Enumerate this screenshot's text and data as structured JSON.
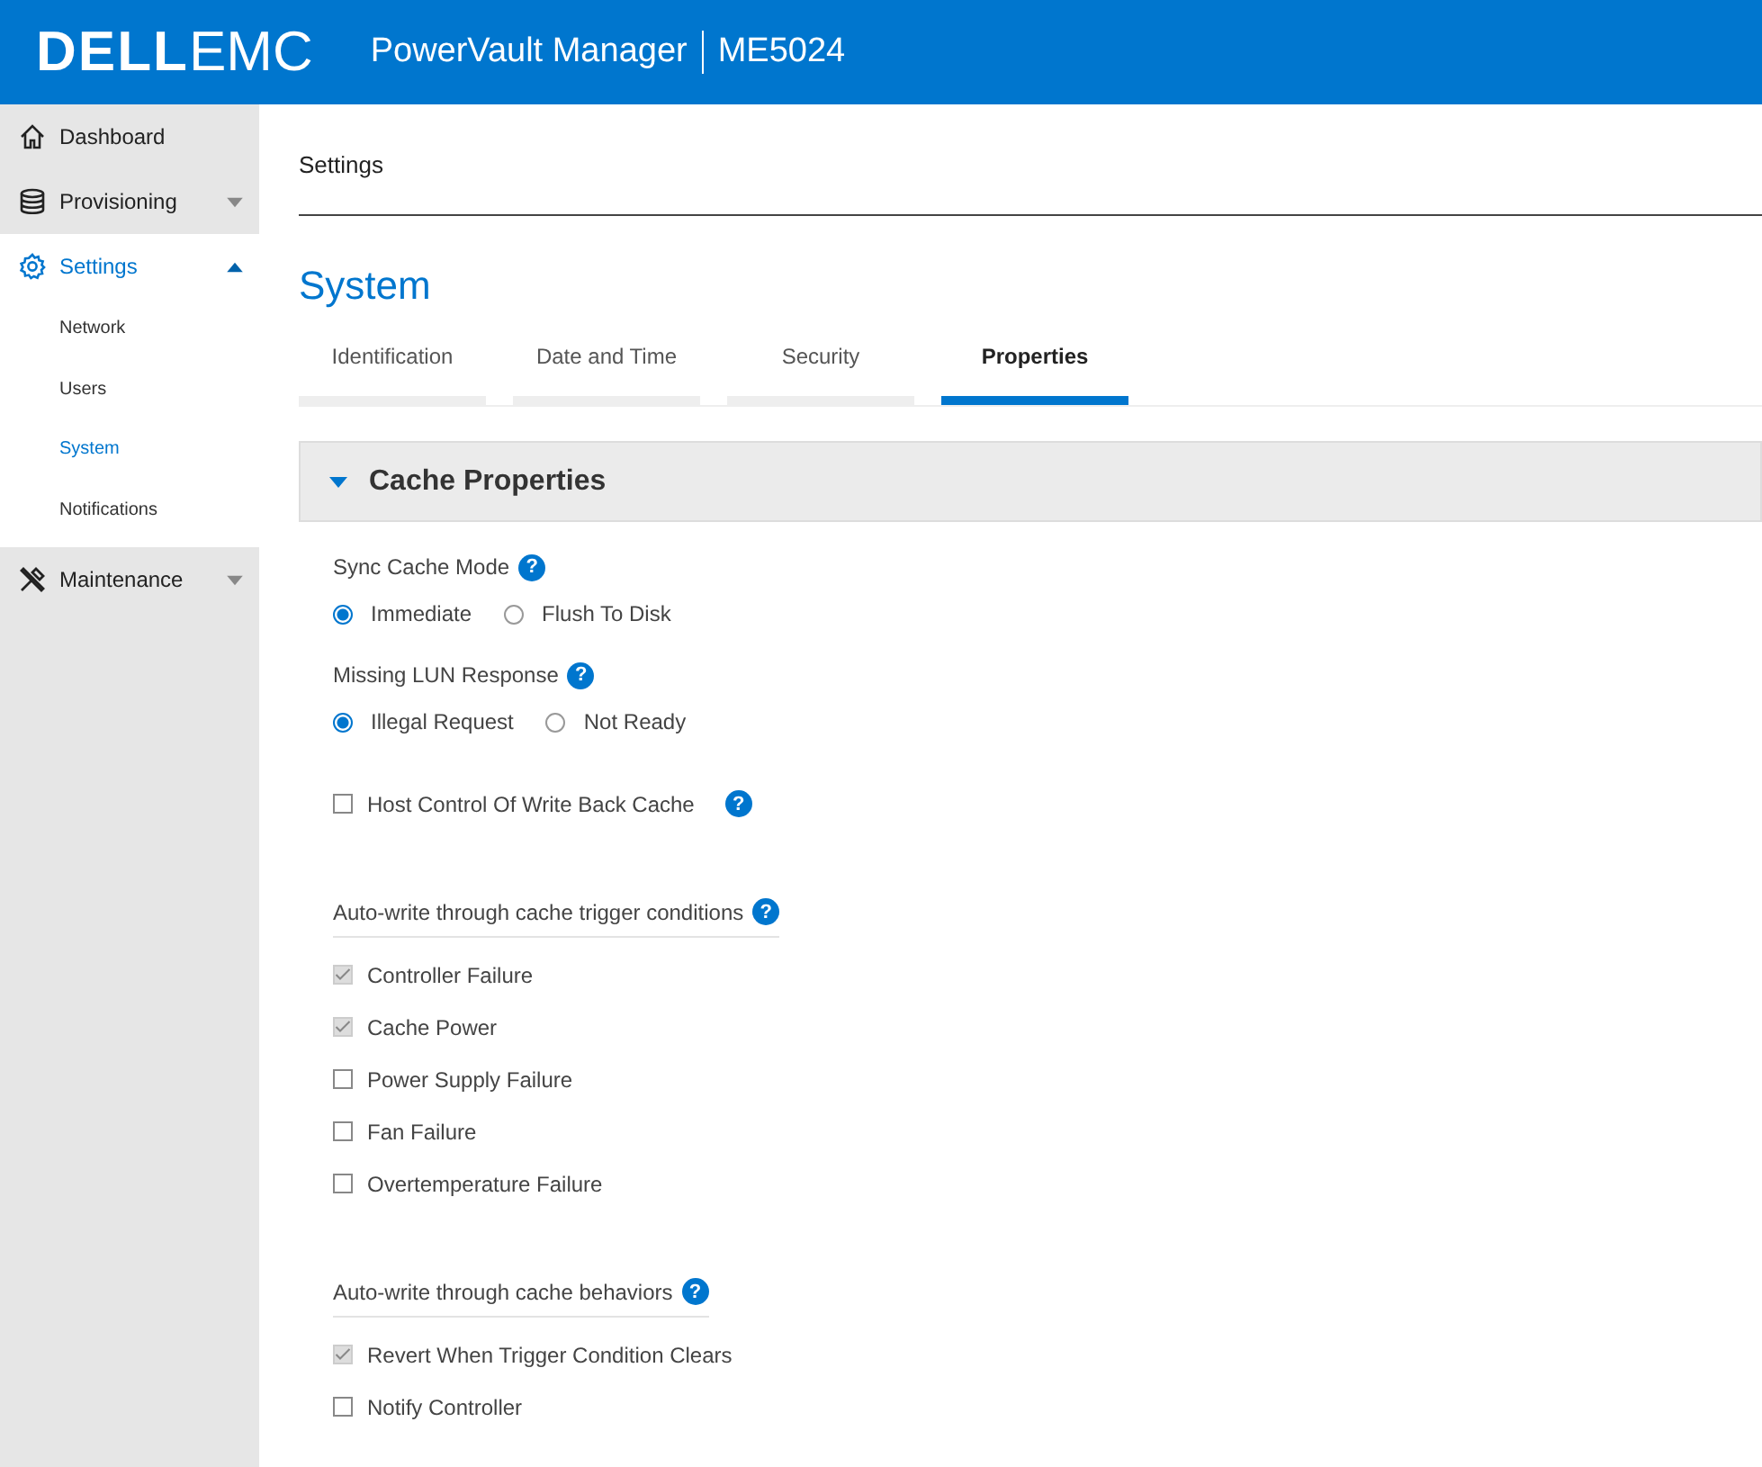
{
  "header": {
    "logo_bold": "DELL",
    "logo_light": "EMC",
    "product": "PowerVault Manager",
    "model": "ME5024"
  },
  "sidebar": {
    "items": [
      {
        "label": "Dashboard",
        "selected": false
      },
      {
        "label": "Provisioning",
        "selected": false,
        "expanded": false
      },
      {
        "label": "Settings",
        "selected": true,
        "expanded": true,
        "children": [
          {
            "label": "Network",
            "selected": false
          },
          {
            "label": "Users",
            "selected": false
          },
          {
            "label": "System",
            "selected": true
          },
          {
            "label": "Notifications",
            "selected": false
          }
        ]
      },
      {
        "label": "Maintenance",
        "selected": false,
        "expanded": false
      }
    ]
  },
  "breadcrumb": "Settings",
  "page_title": "System",
  "tabs": [
    {
      "label": "Identification",
      "selected": false
    },
    {
      "label": "Date and Time",
      "selected": false
    },
    {
      "label": "Security",
      "selected": false
    },
    {
      "label": "Properties",
      "selected": true
    }
  ],
  "panel": {
    "title": "Cache Properties",
    "expanded": true,
    "fields": [
      {
        "kind": "radio",
        "label": "Sync Cache Mode",
        "help": "?",
        "options": [
          {
            "label": "Immediate",
            "selected": true
          },
          {
            "label": "Flush To Disk",
            "selected": false
          }
        ]
      },
      {
        "kind": "radio",
        "label": "Missing LUN Response",
        "help": "?",
        "options": [
          {
            "label": "Illegal Request",
            "selected": true
          },
          {
            "label": "Not Ready",
            "selected": false
          }
        ]
      },
      {
        "kind": "checkbox",
        "label": "Host Control Of Write Back Cache",
        "help": "?",
        "checked": false
      },
      {
        "kind": "group",
        "label": "Auto-write through cache trigger conditions",
        "help": "?",
        "options": [
          {
            "label": "Controller Failure",
            "checked": true
          },
          {
            "label": "Cache Power",
            "checked": true
          },
          {
            "label": "Power Supply Failure",
            "checked": false
          },
          {
            "label": "Fan Failure",
            "checked": false
          },
          {
            "label": "Overtemperature Failure",
            "checked": false
          }
        ]
      },
      {
        "kind": "group",
        "label": "Auto-write through cache behaviors",
        "help": "?",
        "options": [
          {
            "label": "Revert When Trigger Condition Clears",
            "checked": true
          },
          {
            "label": "Notify Controller",
            "checked": false
          }
        ]
      }
    ]
  }
}
